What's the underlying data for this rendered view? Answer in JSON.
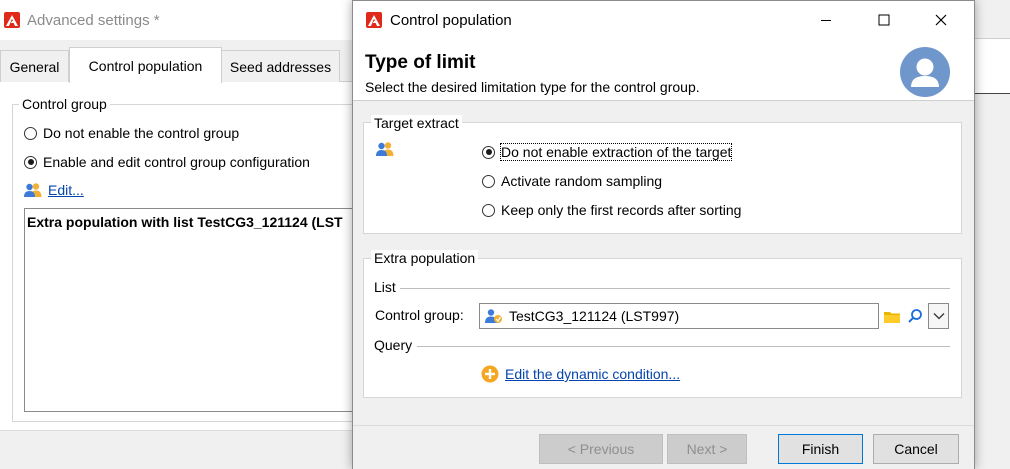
{
  "background_window": {
    "title": "Advanced settings *",
    "tabs": [
      {
        "label": "General"
      },
      {
        "label": "Control population"
      },
      {
        "label": "Seed addresses"
      }
    ],
    "control_group": {
      "legend": "Control group",
      "options": [
        {
          "label": "Do not enable the control group",
          "checked": false
        },
        {
          "label": "Enable and edit control group configuration",
          "checked": true
        }
      ],
      "edit_link": "Edit...",
      "summary": "Extra population with list TestCG3_121124 (LST"
    }
  },
  "dialog": {
    "title": "Control population",
    "heading": "Type of limit",
    "subheading": "Select the desired limitation type for the control group.",
    "target_extract": {
      "legend": "Target extract",
      "options": [
        {
          "label": "Do not enable extraction of the target",
          "checked": true
        },
        {
          "label": "Activate random sampling",
          "checked": false
        },
        {
          "label": "Keep only the first records after sorting",
          "checked": false
        }
      ]
    },
    "extra_population": {
      "legend": "Extra population",
      "list_label": "List",
      "control_group_label": "Control group:",
      "control_group_value": "TestCG3_121124 (LST997)",
      "query_label": "Query",
      "edit_condition_link": "Edit the dynamic condition..."
    },
    "buttons": {
      "previous": "< Previous",
      "next": "Next >",
      "finish": "Finish",
      "cancel": "Cancel"
    }
  },
  "icons": {
    "app_logo": "adobe-logo-icon",
    "people": "people-icon",
    "avatar": "user-avatar-icon",
    "folder": "folder-icon",
    "search": "search-icon",
    "dropdown": "chevron-down-icon",
    "add": "plus-circle-icon"
  },
  "colors": {
    "brand_red": "#e0291b",
    "link_blue": "#0645ad",
    "avatar_blue": "#6f97cc",
    "add_orange": "#f5a623",
    "focus_blue": "#0078d7"
  }
}
